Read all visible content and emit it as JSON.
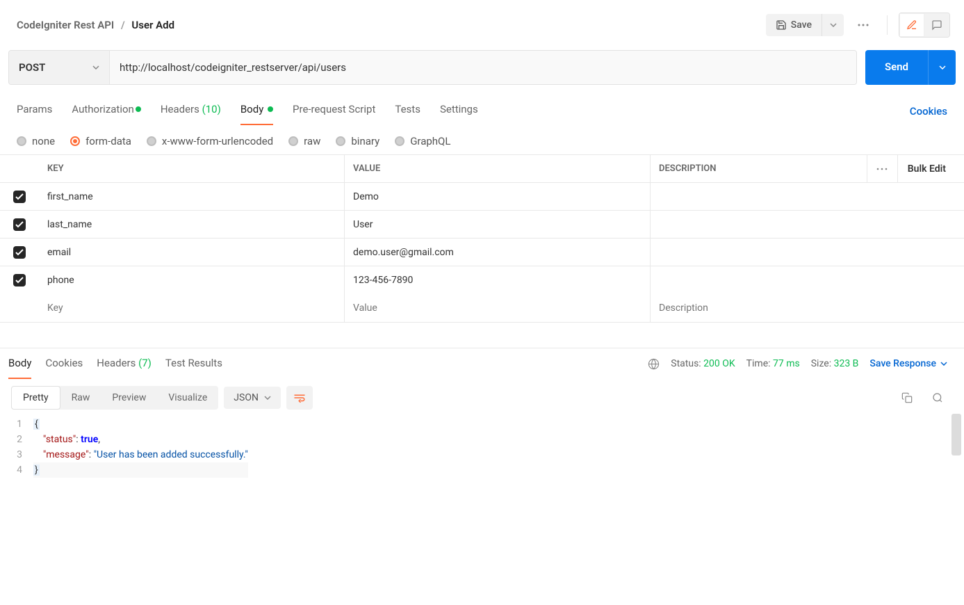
{
  "header": {
    "breadcrumb_root": "CodeIgniter Rest API",
    "breadcrumb_sep": "/",
    "breadcrumb_current": "User Add",
    "save_label": "Save"
  },
  "request": {
    "method": "POST",
    "url": "http://localhost/codeigniter_restserver/api/users",
    "send_label": "Send"
  },
  "tabs": {
    "params": "Params",
    "authorization": "Authorization",
    "headers": "Headers",
    "headers_count": "(10)",
    "body": "Body",
    "prerequest": "Pre-request Script",
    "tests": "Tests",
    "settings": "Settings",
    "cookies_link": "Cookies"
  },
  "body_types": {
    "none": "none",
    "form_data": "form-data",
    "urlencoded": "x-www-form-urlencoded",
    "raw": "raw",
    "binary": "binary",
    "graphql": "GraphQL"
  },
  "fd": {
    "head_key": "KEY",
    "head_value": "VALUE",
    "head_desc": "DESCRIPTION",
    "bulk_edit": "Bulk Edit",
    "rows": [
      {
        "key": "first_name",
        "value": "Demo",
        "desc": ""
      },
      {
        "key": "last_name",
        "value": "User",
        "desc": ""
      },
      {
        "key": "email",
        "value": "demo.user@gmail.com",
        "desc": ""
      },
      {
        "key": "phone",
        "value": "123-456-7890",
        "desc": ""
      }
    ],
    "ph_key": "Key",
    "ph_value": "Value",
    "ph_desc": "Description"
  },
  "resp_tabs": {
    "body": "Body",
    "cookies": "Cookies",
    "headers": "Headers",
    "headers_count": "(7)",
    "test_results": "Test Results"
  },
  "resp_status": {
    "status_label": "Status:",
    "status_val": "200 OK",
    "time_label": "Time:",
    "time_val": "77 ms",
    "size_label": "Size:",
    "size_val": "323 B",
    "save_response": "Save Response"
  },
  "view": {
    "pretty": "Pretty",
    "raw": "Raw",
    "preview": "Preview",
    "visualize": "Visualize",
    "format": "JSON"
  },
  "response_body": {
    "line1": "{",
    "line2_key": "\"status\"",
    "line2_val": "true",
    "line3_key": "\"message\"",
    "line3_val": "\"User has been added successfully.\"",
    "line4": "}",
    "ln1": "1",
    "ln2": "2",
    "ln3": "3",
    "ln4": "4"
  }
}
